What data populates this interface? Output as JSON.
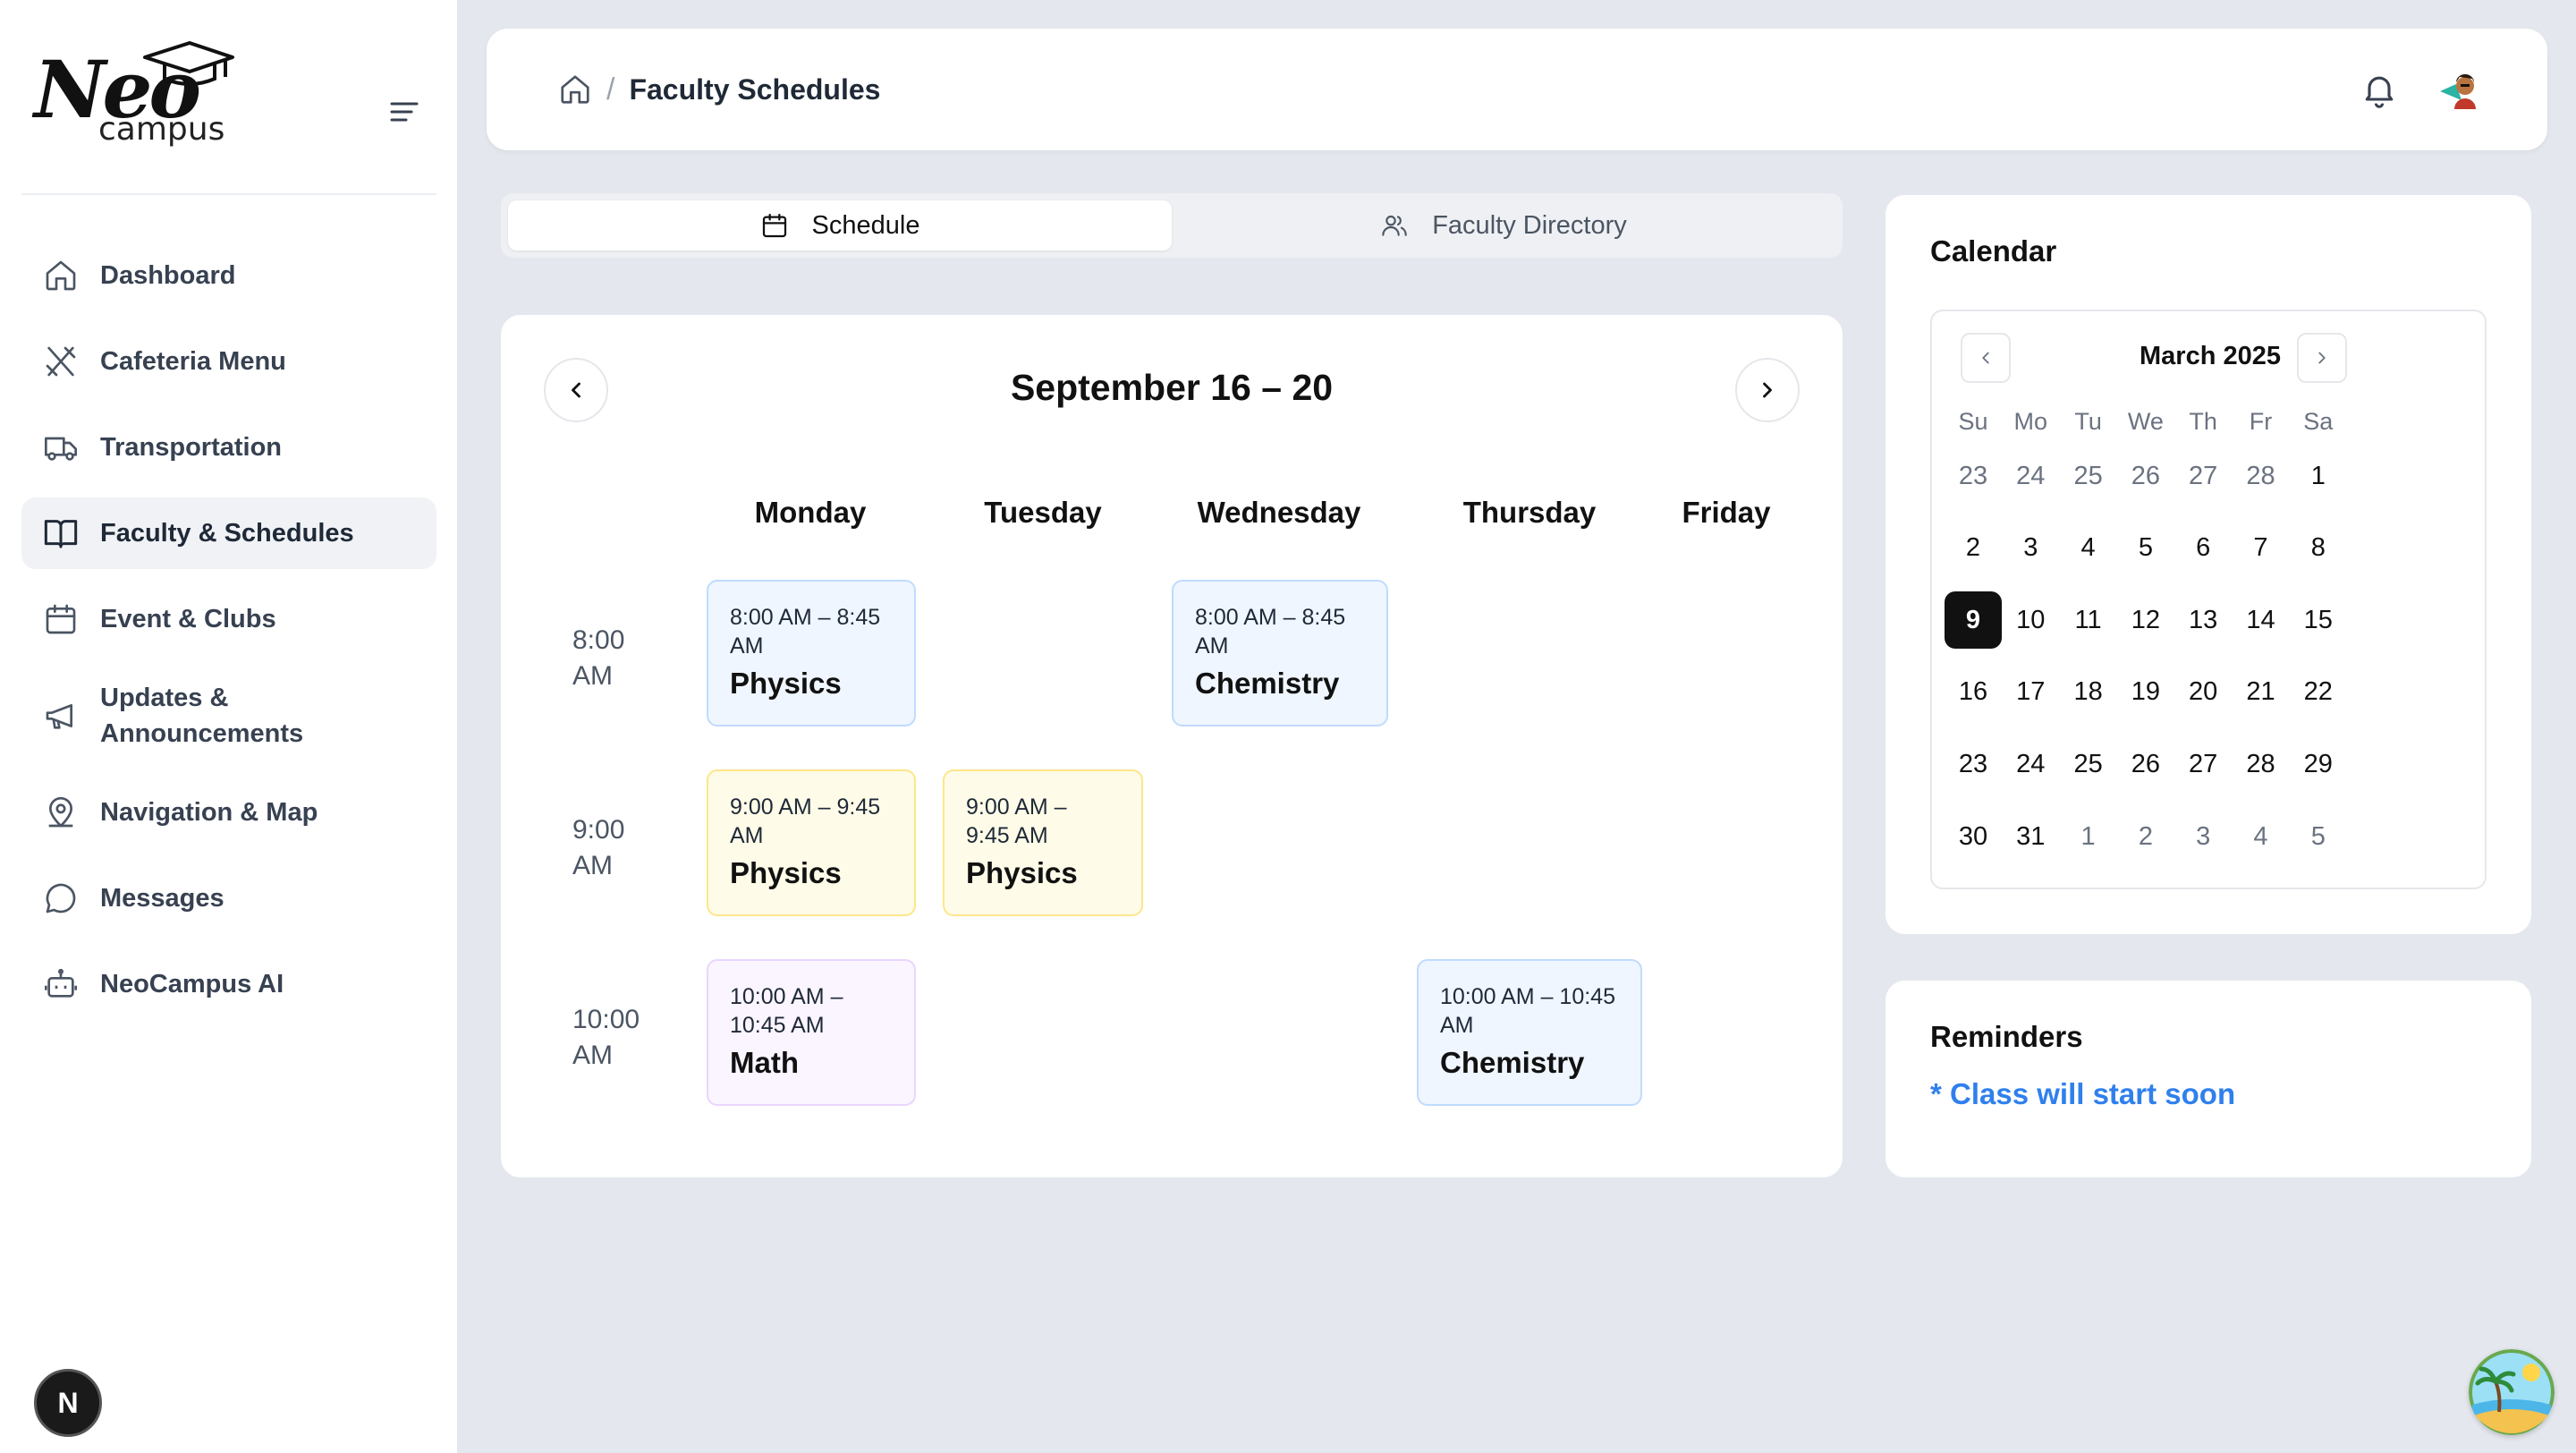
{
  "brand": {
    "line1": "Neo",
    "line2": "campus"
  },
  "sidebar": {
    "items": [
      {
        "label": "Dashboard",
        "icon": "home-icon"
      },
      {
        "label": "Cafeteria Menu",
        "icon": "utensils-icon"
      },
      {
        "label": "Transportation",
        "icon": "truck-icon"
      },
      {
        "label": "Faculty & Schedules",
        "icon": "book-open-icon"
      },
      {
        "label": "Event & Clubs",
        "icon": "calendar-icon"
      },
      {
        "label": "Updates &\nAnnouncements",
        "icon": "megaphone-icon"
      },
      {
        "label": "Navigation & Map",
        "icon": "map-pin-icon"
      },
      {
        "label": "Messages",
        "icon": "message-icon"
      },
      {
        "label": "NeoCampus AI",
        "icon": "bot-icon"
      }
    ],
    "active_index": 3,
    "badge": "N"
  },
  "header": {
    "separator": "/",
    "title": "Faculty Schedules"
  },
  "tabs": {
    "schedule": "Schedule",
    "faculty": "Faculty Directory",
    "active": "schedule"
  },
  "schedule": {
    "week_title": "September 16 – 20",
    "days": [
      "Monday",
      "Tuesday",
      "Wednesday",
      "Thursday",
      "Friday"
    ],
    "times": [
      {
        "line1": "8:00",
        "line2": "AM"
      },
      {
        "line1": "9:00",
        "line2": "AM"
      },
      {
        "line1": "10:00",
        "line2": "AM"
      }
    ],
    "events": [
      {
        "time_l1": "8:00 AM – 8:45",
        "time_l2": "AM",
        "name": "Physics"
      },
      {
        "time_l1": "8:00 AM – 8:45",
        "time_l2": "AM",
        "name": "Chemistry"
      },
      {
        "time_l1": "9:00 AM – 9:45",
        "time_l2": "AM",
        "name": "Physics"
      },
      {
        "time_l1": "9:00 AM –",
        "time_l2": "9:45 AM",
        "name": "Physics"
      },
      {
        "time_l1": "10:00 AM –",
        "time_l2": "10:45 AM",
        "name": "Math"
      },
      {
        "time_l1": "10:00 AM – 10:45",
        "time_l2": "AM",
        "name": "Chemistry"
      }
    ]
  },
  "calendar": {
    "title": "Calendar",
    "month": "March 2025",
    "weekdays": [
      "Su",
      "Mo",
      "Tu",
      "We",
      "Th",
      "Fr",
      "Sa"
    ],
    "weeks": [
      [
        "23",
        "24",
        "25",
        "26",
        "27",
        "28",
        "1"
      ],
      [
        "2",
        "3",
        "4",
        "5",
        "6",
        "7",
        "8"
      ],
      [
        "9",
        "10",
        "11",
        "12",
        "13",
        "14",
        "15"
      ],
      [
        "16",
        "17",
        "18",
        "19",
        "20",
        "21",
        "22"
      ],
      [
        "23",
        "24",
        "25",
        "26",
        "27",
        "28",
        "29"
      ],
      [
        "30",
        "31",
        "1",
        "2",
        "3",
        "4",
        "5"
      ]
    ],
    "selected": "9"
  },
  "reminders": {
    "title": "Reminders",
    "items": [
      "* Class will start soon"
    ]
  },
  "colors": {
    "accent": "#2f80ed",
    "selected_day": "#111111",
    "event_blue": "#eff6ff",
    "event_yellow": "#fefce8",
    "event_purple": "#faf5ff"
  }
}
